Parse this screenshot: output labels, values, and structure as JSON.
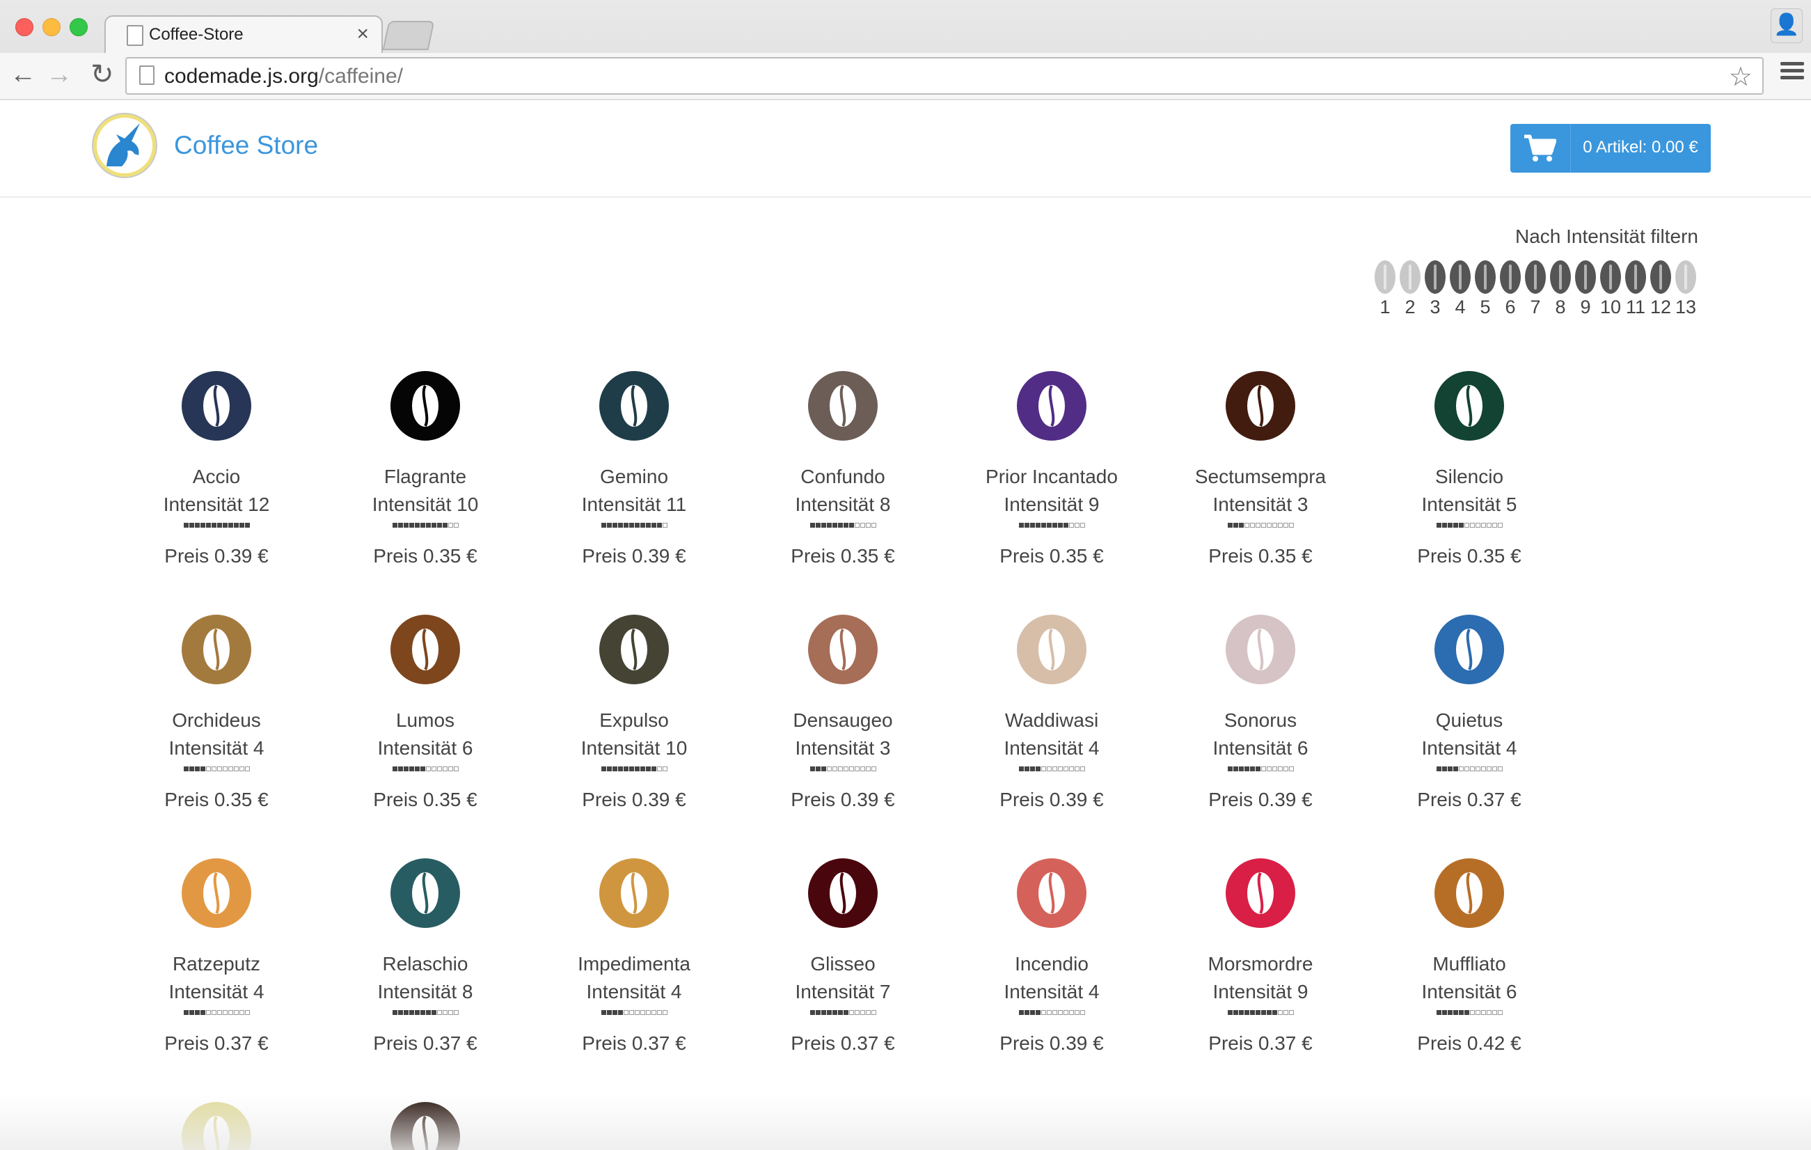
{
  "browser": {
    "tab_title": "Coffee-Store",
    "tab_close": "×",
    "url_host": "codemade.js.org",
    "url_path": "/caffeine/"
  },
  "header": {
    "brand": "Coffee Store",
    "cart_label": "0 Artikel: 0.00 €",
    "brand_color": "#3b96dc",
    "cart_color": "#3a97dd"
  },
  "filter": {
    "label": "Nach Intensität filtern",
    "levels": [
      {
        "n": "1",
        "active": false
      },
      {
        "n": "2",
        "active": false
      },
      {
        "n": "3",
        "active": true
      },
      {
        "n": "4",
        "active": true
      },
      {
        "n": "5",
        "active": true
      },
      {
        "n": "6",
        "active": true
      },
      {
        "n": "7",
        "active": true
      },
      {
        "n": "8",
        "active": true
      },
      {
        "n": "9",
        "active": true
      },
      {
        "n": "10",
        "active": true
      },
      {
        "n": "11",
        "active": true
      },
      {
        "n": "12",
        "active": true
      },
      {
        "n": "13",
        "active": false
      }
    ],
    "active_color": "#555555",
    "inactive_color": "#c8c8c8"
  },
  "products": [
    {
      "name": "Accio",
      "intensity": 12,
      "intensity_label": "Intensität 12",
      "price": "Preis 0.39 €",
      "color": "#273656"
    },
    {
      "name": "Flagrante",
      "intensity": 10,
      "intensity_label": "Intensität 10",
      "price": "Preis 0.35 €",
      "color": "#050505"
    },
    {
      "name": "Gemino",
      "intensity": 11,
      "intensity_label": "Intensität 11",
      "price": "Preis 0.39 €",
      "color": "#1e3d48"
    },
    {
      "name": "Confundo",
      "intensity": 8,
      "intensity_label": "Intensität 8",
      "price": "Preis 0.35 €",
      "color": "#6c5d57"
    },
    {
      "name": "Prior Incantado",
      "intensity": 9,
      "intensity_label": "Intensität 9",
      "price": "Preis 0.35 €",
      "color": "#512d86"
    },
    {
      "name": "Sectumsempra",
      "intensity": 3,
      "intensity_label": "Intensität 3",
      "price": "Preis 0.35 €",
      "color": "#421c0f"
    },
    {
      "name": "Silencio",
      "intensity": 5,
      "intensity_label": "Intensität 5",
      "price": "Preis 0.35 €",
      "color": "#124333"
    },
    {
      "name": "Orchideus",
      "intensity": 4,
      "intensity_label": "Intensität 4",
      "price": "Preis 0.35 €",
      "color": "#a37a3e"
    },
    {
      "name": "Lumos",
      "intensity": 6,
      "intensity_label": "Intensität 6",
      "price": "Preis 0.35 €",
      "color": "#7e461d"
    },
    {
      "name": "Expulso",
      "intensity": 10,
      "intensity_label": "Intensität 10",
      "price": "Preis 0.39 €",
      "color": "#454434"
    },
    {
      "name": "Densaugeo",
      "intensity": 3,
      "intensity_label": "Intensität 3",
      "price": "Preis 0.39 €",
      "color": "#a66d57"
    },
    {
      "name": "Waddiwasi",
      "intensity": 4,
      "intensity_label": "Intensität 4",
      "price": "Preis 0.39 €",
      "color": "#d6bea9"
    },
    {
      "name": "Sonorus",
      "intensity": 6,
      "intensity_label": "Intensität 6",
      "price": "Preis 0.39 €",
      "color": "#d5c3c5"
    },
    {
      "name": "Quietus",
      "intensity": 4,
      "intensity_label": "Intensität 4",
      "price": "Preis 0.37 €",
      "color": "#2c6cb0"
    },
    {
      "name": "Ratzeputz",
      "intensity": 4,
      "intensity_label": "Intensität 4",
      "price": "Preis 0.37 €",
      "color": "#e29843"
    },
    {
      "name": "Relaschio",
      "intensity": 8,
      "intensity_label": "Intensität 8",
      "price": "Preis 0.37 €",
      "color": "#275d62"
    },
    {
      "name": "Impedimenta",
      "intensity": 4,
      "intensity_label": "Intensität 4",
      "price": "Preis 0.37 €",
      "color": "#d0963f"
    },
    {
      "name": "Glisseo",
      "intensity": 7,
      "intensity_label": "Intensität 7",
      "price": "Preis 0.37 €",
      "color": "#4a060d"
    },
    {
      "name": "Incendio",
      "intensity": 4,
      "intensity_label": "Intensität 4",
      "price": "Preis 0.39 €",
      "color": "#d5625a"
    },
    {
      "name": "Morsmordre",
      "intensity": 9,
      "intensity_label": "Intensität 9",
      "price": "Preis 0.37 €",
      "color": "#d91f46"
    },
    {
      "name": "Muffliato",
      "intensity": 6,
      "intensity_label": "Intensität 6",
      "price": "Preis 0.42 €",
      "color": "#b66e26"
    },
    {
      "name": "",
      "intensity": 0,
      "intensity_label": "",
      "price": "",
      "color": "#e2dc9f"
    },
    {
      "name": "",
      "intensity": 0,
      "intensity_label": "",
      "price": "",
      "color": "#2d1a13"
    }
  ]
}
